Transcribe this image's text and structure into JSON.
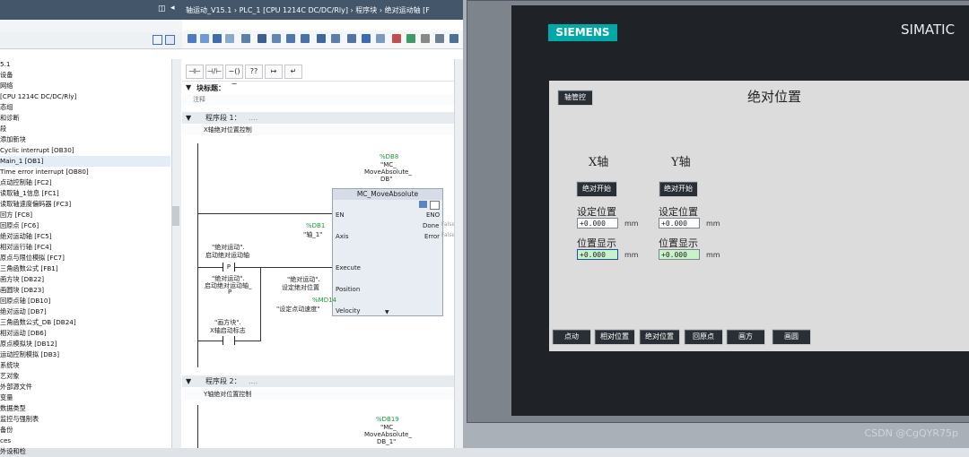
{
  "tree": {
    "items": [
      "5.1",
      "设备",
      "网络",
      "[CPU 1214C DC/DC/Rly]",
      "态组",
      "和诊断",
      "段",
      "添加新块",
      "Cyclic interrupt [OB30]",
      "Main_1 [OB1]",
      "Time error interrupt [OB80]",
      "点动控制轴 [FC2]",
      "读取轴_1信息 [FC1]",
      "读取轴速度偏码器 [FC3]",
      "回方 [FC8]",
      "回原点 [FC6]",
      "绝对运动轴 [FC5]",
      "相对运行轴 [FC4]",
      "原点与限位模拟 [FC7]",
      "三角函数公式 [FB1]",
      "画方块 [DB22]",
      "画圆块 [DB23]",
      "回原点轴 [DB10]",
      "绝对运动 [DB7]",
      "三角函数公式_DB [DB24]",
      "相对运动 [DB6]",
      "原点模拟块 [DB12]",
      "运动控制模拟 [DB3]",
      "系统块",
      "艺对象",
      "外部源文件",
      "变量",
      "数据类型",
      "监控与强制表",
      "备份",
      "ces",
      "外设和检"
    ],
    "selected_index": 9
  },
  "editor": {
    "title": "轴运动_V15.1 › PLC_1 [CPU 1214C DC/DC/Rly] › 程序块 › 绝对运动轴 [F",
    "ladder_buttons": [
      "⊣⊢",
      "⊣/⊢",
      "−()−",
      "??",
      "↦",
      "↵"
    ],
    "block_title_label": "块标题：",
    "comment": "注释",
    "network1": {
      "label": "程序段 1：",
      "dots": "....",
      "title": "X轴绝对位置控制"
    },
    "network2": {
      "label": "程序段 2：",
      "dots": "....",
      "title": "Y轴绝对位置控制"
    },
    "db8": {
      "name": "%DB8",
      "sub1": "\"MC_",
      "sub2": "MoveAbsolute_",
      "sub3": "DB\""
    },
    "db19": {
      "name": "%DB19",
      "sub1": "\"MC_",
      "sub2": "MoveAbsolute_",
      "sub3": "DB_1\""
    },
    "fb": {
      "name": "MC_MoveAbsolute",
      "en": "EN",
      "eno": "ENO",
      "axis": "Axis",
      "done": "Done",
      "error": "Error",
      "execute": "Execute",
      "position": "Position",
      "velocity": "Velocity",
      "false1": "False",
      "false2": "False"
    },
    "axis_in": {
      "addr": "%DB1",
      "name": "\"轴_1\""
    },
    "contact1": {
      "line1": "\"绝对运动\".",
      "line2": "启动绝对运动轴",
      "letter": "P"
    },
    "contact2": {
      "line1": "\"绝对运动\".",
      "line2": "启动绝对运动轴_",
      "line3": "P"
    },
    "contact3": {
      "line1": "\"画方块\".",
      "line2": "X轴启动标志"
    },
    "pos_in": {
      "line1": "\"绝对运动\".",
      "line2": "设定绝对位置"
    },
    "vel_in": {
      "addr": "%MD14",
      "name": "\"设定点动速度\""
    }
  },
  "hmi": {
    "brand": "SIEMENS",
    "product": "SIMATIC",
    "back_button": "轴管控",
    "title": "绝对位置",
    "x_axis": {
      "label": "X轴",
      "start_button": "绝对开始",
      "set_label": "设定位置",
      "set_value": "+0.000",
      "show_label": "位置显示",
      "show_value": "+0.000",
      "unit": "mm"
    },
    "y_axis": {
      "label": "Y轴",
      "start_button": "绝对开始",
      "set_label": "设定位置",
      "set_value": "+0.000",
      "show_label": "位置显示",
      "show_value": "+0.000",
      "unit": "mm"
    },
    "nav": [
      "点动",
      "相对位置",
      "绝对位置",
      "回原点",
      "画方",
      "画圆"
    ]
  },
  "watermark": "CSDN @CgQYR75p",
  "colors": {
    "dark_bar": "#44566a",
    "hmi_screen": "#dcdcdc",
    "accent_green": "#1b9a3a",
    "siemens_teal": "#009999"
  }
}
